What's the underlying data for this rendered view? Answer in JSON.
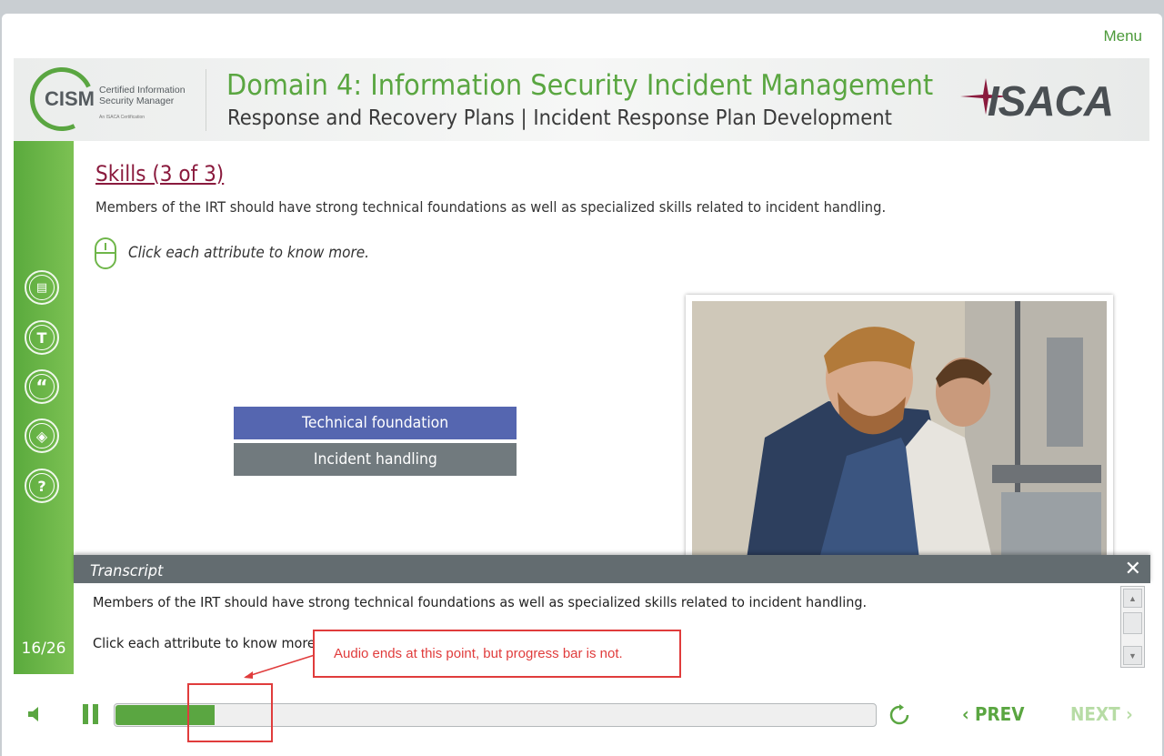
{
  "nav": {
    "menu_label": "Menu"
  },
  "header": {
    "cism_logo_text": "CISM",
    "cism_subtitle_line1": "Certified Information",
    "cism_subtitle_line2": "Security Manager",
    "cism_subtitle_line3": "An ISACA Certification",
    "domain_title": "Domain 4: Information Security Incident Management",
    "subtitle": "Response and Recovery Plans | Incident Response Plan Development",
    "brand": "ISACA"
  },
  "sidebar": {
    "buttons": [
      {
        "icon": "notes-icon",
        "glyph": "▤"
      },
      {
        "icon": "glossary-icon",
        "glyph": "T"
      },
      {
        "icon": "quote-icon",
        "glyph": "“"
      },
      {
        "icon": "resources-icon",
        "glyph": "◈"
      },
      {
        "icon": "help-icon",
        "glyph": "?"
      }
    ],
    "page_counter": "16/26"
  },
  "slide": {
    "title": "Skills (3 of 3)",
    "description": "Members of the IRT should have strong technical foundations as well as specialized skills related to incident handling.",
    "instruction": "Click each attribute to know more.",
    "attributes": [
      "Technical foundation",
      "Incident handling"
    ]
  },
  "transcript": {
    "title": "Transcript",
    "close_glyph": "✕",
    "lines": [
      "Members of the IRT should have strong technical foundations as well as specialized skills related to incident handling.",
      "Click each attribute to know more."
    ]
  },
  "annotation": {
    "callout_text": "Audio ends at this point, but progress bar is not."
  },
  "controls": {
    "progress_fraction": 0.13,
    "prev_label": "PREV",
    "next_label": "NEXT",
    "prev_glyph": "‹",
    "next_glyph": "›"
  },
  "colors": {
    "accent_green": "#5aa641",
    "title_maroon": "#8a1a3d",
    "attribute_blue": "#5566b0",
    "attribute_gray": "#717a7e",
    "annotation_red": "#e03c3c"
  }
}
